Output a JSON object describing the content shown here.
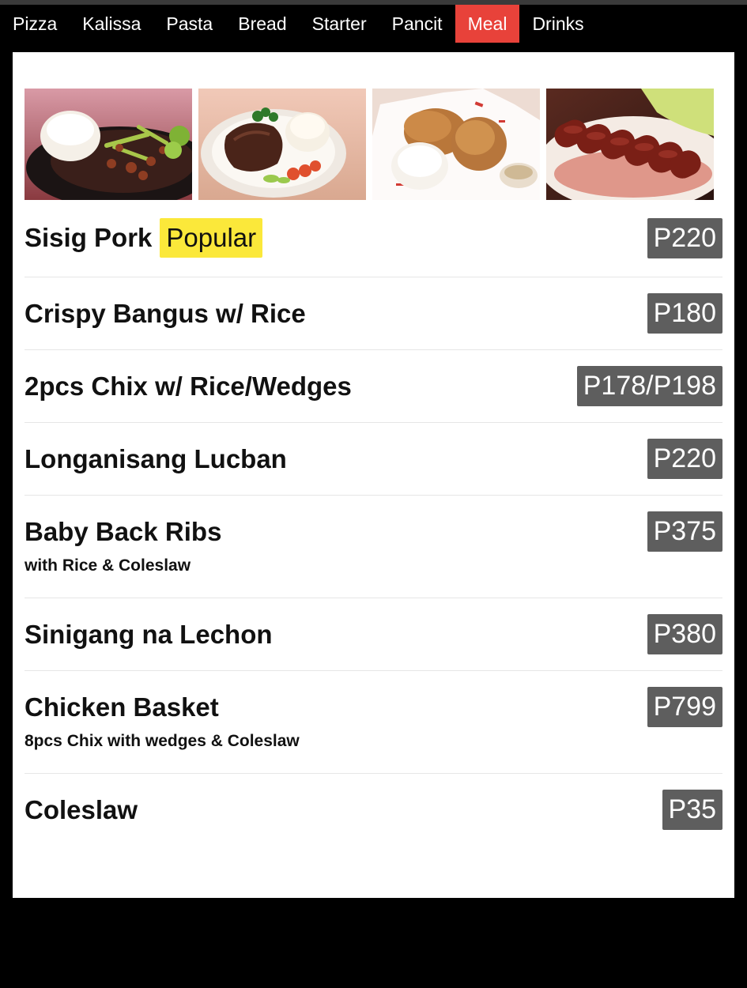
{
  "tabs": [
    {
      "label": "Pizza",
      "active": false
    },
    {
      "label": "Kalissa",
      "active": false
    },
    {
      "label": "Pasta",
      "active": false
    },
    {
      "label": "Bread",
      "active": false
    },
    {
      "label": "Starter",
      "active": false
    },
    {
      "label": "Pancit",
      "active": false
    },
    {
      "label": "Meal",
      "active": true
    },
    {
      "label": "Drinks",
      "active": false
    }
  ],
  "colors": {
    "active_tab": "#e8423a",
    "popular_badge": "#fbe83a",
    "price_badge": "#5e5e5e",
    "background": "#000000",
    "panel": "#ffffff"
  },
  "photos": [
    {
      "name": "sisig-pork-photo"
    },
    {
      "name": "steak-plate-photo"
    },
    {
      "name": "fried-chicken-basket-photo"
    },
    {
      "name": "longganisa-photo"
    }
  ],
  "menu": {
    "items": [
      {
        "name": "Sisig Pork",
        "badge": "Popular",
        "price": "P220"
      },
      {
        "name": "Crispy Bangus w/ Rice",
        "price": "P180"
      },
      {
        "name": "2pcs Chix w/ Rice/Wedges",
        "price": "P178/P198"
      },
      {
        "name": "Longanisang Lucban",
        "price": "P220"
      },
      {
        "name": "Baby Back Ribs",
        "price": "P375",
        "desc": "with Rice & Coleslaw"
      },
      {
        "name": "Sinigang na Lechon",
        "price": "P380"
      },
      {
        "name": "Chicken Basket",
        "price": "P799",
        "desc": "8pcs Chix with wedges & Coleslaw"
      },
      {
        "name": "Coleslaw",
        "price": "P35"
      }
    ]
  }
}
